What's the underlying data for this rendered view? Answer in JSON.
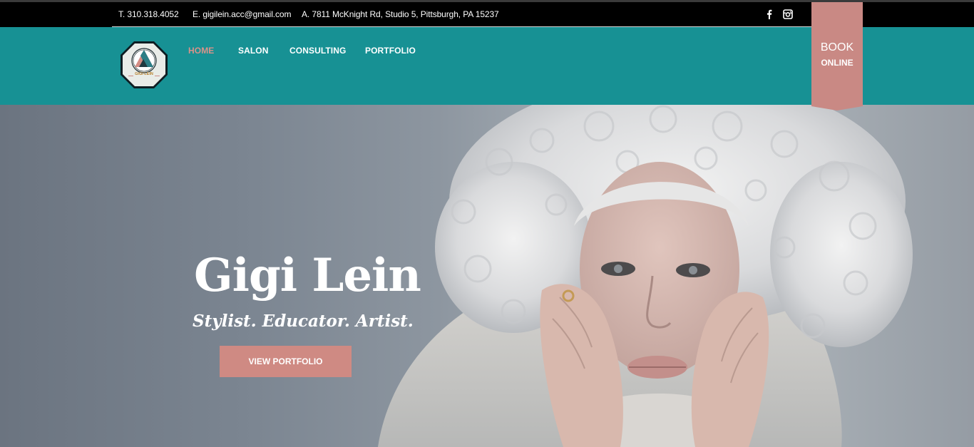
{
  "topbar": {
    "phone": "T. 310.318.4052",
    "email": "E. gigilein.acc@gmail.com",
    "address": "A. 7811 McKnight Rd, Studio 5, Pittsburgh, PA 15237",
    "social_icons": [
      "facebook-icon",
      "instagram-icon"
    ]
  },
  "logo": {
    "text": "GIGI LEIN"
  },
  "nav": {
    "items": [
      {
        "label": "HOME",
        "active": true
      },
      {
        "label": "SALON",
        "active": false
      },
      {
        "label": "CONSULTING",
        "active": false
      },
      {
        "label": "PORTFOLIO",
        "active": false
      }
    ]
  },
  "book": {
    "line1": "BOOK",
    "line2": "ONLINE"
  },
  "hero": {
    "title": "Gigi Lein",
    "subtitle": "Stylist. Educator. Artist.",
    "button": "VIEW PORTFOLIO"
  },
  "colors": {
    "teal_nav": "#179194",
    "rose_accent": "#cf8a83",
    "active_nav": "#d8938a",
    "topbar": "#000000"
  }
}
